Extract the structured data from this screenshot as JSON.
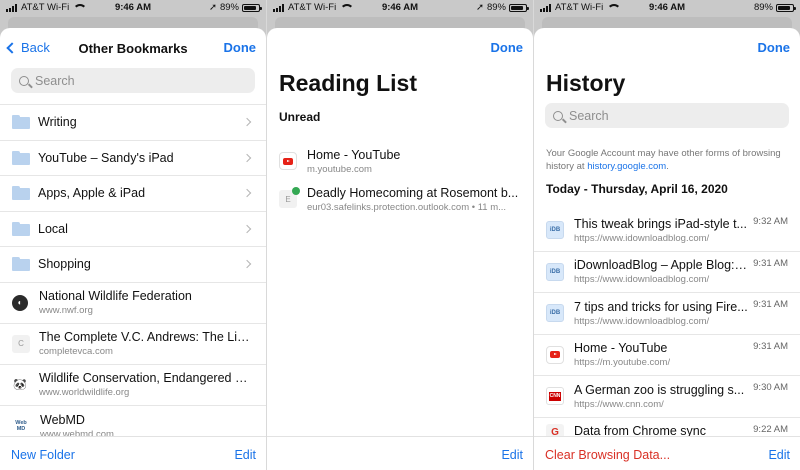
{
  "status": {
    "carrier": "AT&T Wi-Fi",
    "time": "9:46 AM",
    "battery": "89%",
    "battery_level": 0.89
  },
  "bookmarks": {
    "back_label": "Back",
    "title": "Other Bookmarks",
    "done_label": "Done",
    "search_placeholder": "Search",
    "folders": [
      {
        "label": "Writing"
      },
      {
        "label": "YouTube – Sandy's iPad"
      },
      {
        "label": "Apps, Apple & iPad"
      },
      {
        "label": "Local"
      },
      {
        "label": "Shopping"
      }
    ],
    "items": [
      {
        "title": "National Wildlife Federation",
        "url": "www.nwf.org",
        "icon": "nwf-favicon"
      },
      {
        "title": "The Complete V.C. Andrews: The Libr...",
        "url": "completevca.com",
        "icon": "letter-c-favicon",
        "letter": "C"
      },
      {
        "title": "Wildlife Conservation, Endangered Sp...",
        "url": "www.worldwildlife.org",
        "icon": "wwf-panda-favicon"
      },
      {
        "title": "WebMD",
        "url": "www.webmd.com",
        "icon": "webmd-favicon",
        "letter": "Web MD"
      }
    ],
    "new_folder_label": "New Folder",
    "edit_label": "Edit"
  },
  "reading_list": {
    "done_label": "Done",
    "title": "Reading List",
    "section": "Unread",
    "items": [
      {
        "title": "Home - YouTube",
        "url": "m.youtube.com",
        "icon": "youtube-favicon"
      },
      {
        "title": "Deadly Homecoming at Rosemont b...",
        "url": "eur03.safelinks.protection.outlook.com • 11 m...",
        "icon": "letter-e-favicon",
        "letter": "E"
      }
    ],
    "edit_label": "Edit"
  },
  "history": {
    "done_label": "Done",
    "title": "History",
    "search_placeholder": "Search",
    "info_text": "Your Google Account may have other forms of browsing history at",
    "info_link": "history.google.com",
    "info_end": ".",
    "date_header": "Today - Thursday, April 16, 2020",
    "items": [
      {
        "title": "This tweak brings iPad-style t...",
        "url": "https://www.idownloadblog.com/",
        "time": "9:32 AM",
        "icon": "idb-favicon"
      },
      {
        "title": "iDownloadBlog – Apple Blog: i...",
        "url": "https://www.idownloadblog.com/",
        "time": "9:31 AM",
        "icon": "idb-favicon"
      },
      {
        "title": "7 tips and tricks for using Fire...",
        "url": "https://www.idownloadblog.com/",
        "time": "9:31 AM",
        "icon": "idb-favicon"
      },
      {
        "title": "Home - YouTube",
        "url": "https://m.youtube.com/",
        "time": "9:31 AM",
        "icon": "youtube-favicon"
      },
      {
        "title": "A German zoo is struggling s...",
        "url": "https://www.cnn.com/",
        "time": "9:30 AM",
        "icon": "cnn-favicon"
      },
      {
        "title": "Data from Chrome sync",
        "url": "",
        "time": "9:22 AM",
        "icon": "google-favicon"
      }
    ],
    "clear_label": "Clear Browsing Data...",
    "edit_label": "Edit"
  }
}
